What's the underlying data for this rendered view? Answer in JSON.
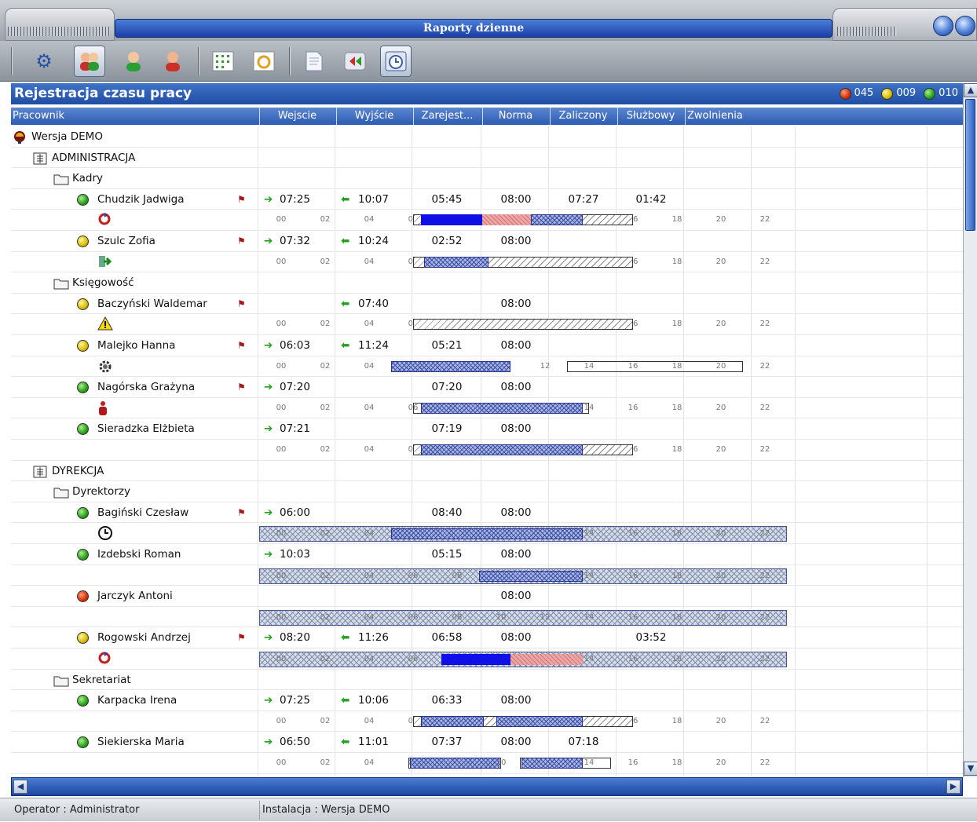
{
  "window": {
    "title": "Raporty dzienne"
  },
  "toolbar": {
    "icons": [
      "gear-icon",
      "users-icon",
      "user-green-icon",
      "user-red-icon",
      "calendar-grid-icon",
      "calendar-refresh-icon",
      "document-icon",
      "back-icon",
      "clock-window-icon"
    ]
  },
  "header": {
    "title": "Rejestracja czasu pracy",
    "count_red": "045",
    "count_yellow": "009",
    "count_green": "010"
  },
  "columns": {
    "employee": "Pracownik",
    "in": "Wejscie",
    "out": "Wyjście",
    "registered": "Zarejest...",
    "norm": "Norma",
    "credited": "Zaliczony",
    "business": "Służbowy",
    "leave": "Zwolnienia"
  },
  "tree": {
    "root": "Wersja DEMO",
    "dept1": "ADMINISTRACJA",
    "grp_kadry": "Kadry",
    "grp_ksiegowosc": "Księgowość",
    "dept2": "DYREKCJA",
    "grp_dyrektorzy": "Dyrektorzy",
    "grp_sekretariat": "Sekretariat"
  },
  "employees": [
    {
      "name": "Chudzik Jadwiga",
      "in": "07:25",
      "out": "10:07",
      "reg": "05:45",
      "norm": "08:00",
      "cred": "07:27",
      "biz": "01:42",
      "status": "green"
    },
    {
      "name": "Szulc Zofia",
      "in": "07:32",
      "out": "10:24",
      "reg": "02:52",
      "norm": "08:00",
      "cred": "",
      "biz": "",
      "status": "yellow"
    },
    {
      "name": "Baczyński Waldemar",
      "in": "",
      "out": "07:40",
      "reg": "",
      "norm": "08:00",
      "cred": "",
      "biz": "",
      "status": "yellow"
    },
    {
      "name": "Malejko Hanna",
      "in": "06:03",
      "out": "11:24",
      "reg": "05:21",
      "norm": "08:00",
      "cred": "",
      "biz": "",
      "status": "yellow"
    },
    {
      "name": "Nagórska Grażyna",
      "in": "07:20",
      "out": "",
      "reg": "07:20",
      "norm": "08:00",
      "cred": "",
      "biz": "",
      "status": "green"
    },
    {
      "name": "Sieradzka Elżbieta",
      "in": "07:21",
      "out": "",
      "reg": "07:19",
      "norm": "08:00",
      "cred": "",
      "biz": "",
      "status": "green"
    },
    {
      "name": "Bagiński Czesław",
      "in": "06:00",
      "out": "",
      "reg": "08:40",
      "norm": "08:00",
      "cred": "",
      "biz": "",
      "status": "green"
    },
    {
      "name": "Izdebski Roman",
      "in": "10:03",
      "out": "",
      "reg": "05:15",
      "norm": "08:00",
      "cred": "",
      "biz": "",
      "status": "green"
    },
    {
      "name": "Jarczyk Antoni",
      "in": "",
      "out": "",
      "reg": "",
      "norm": "08:00",
      "cred": "",
      "biz": "",
      "status": "red"
    },
    {
      "name": "Rogowski Andrzej",
      "in": "08:20",
      "out": "11:26",
      "reg": "06:58",
      "norm": "08:00",
      "cred": "",
      "biz": "03:52",
      "status": "yellow"
    },
    {
      "name": "Karpacka Irena",
      "in": "07:25",
      "out": "10:06",
      "reg": "06:33",
      "norm": "08:00",
      "cred": "",
      "biz": "",
      "status": "green"
    },
    {
      "name": "Siekierska Maria",
      "in": "06:50",
      "out": "11:01",
      "reg": "07:37",
      "norm": "08:00",
      "cred": "07:18",
      "biz": "",
      "status": "green"
    }
  ],
  "hours": [
    "00",
    "02",
    "04",
    "06",
    "08",
    "10",
    "12",
    "14",
    "16",
    "18",
    "20",
    "22"
  ],
  "statusbar": {
    "operator": "Operator : Administrator",
    "installation": "Instalacja : Wersja DEMO"
  }
}
